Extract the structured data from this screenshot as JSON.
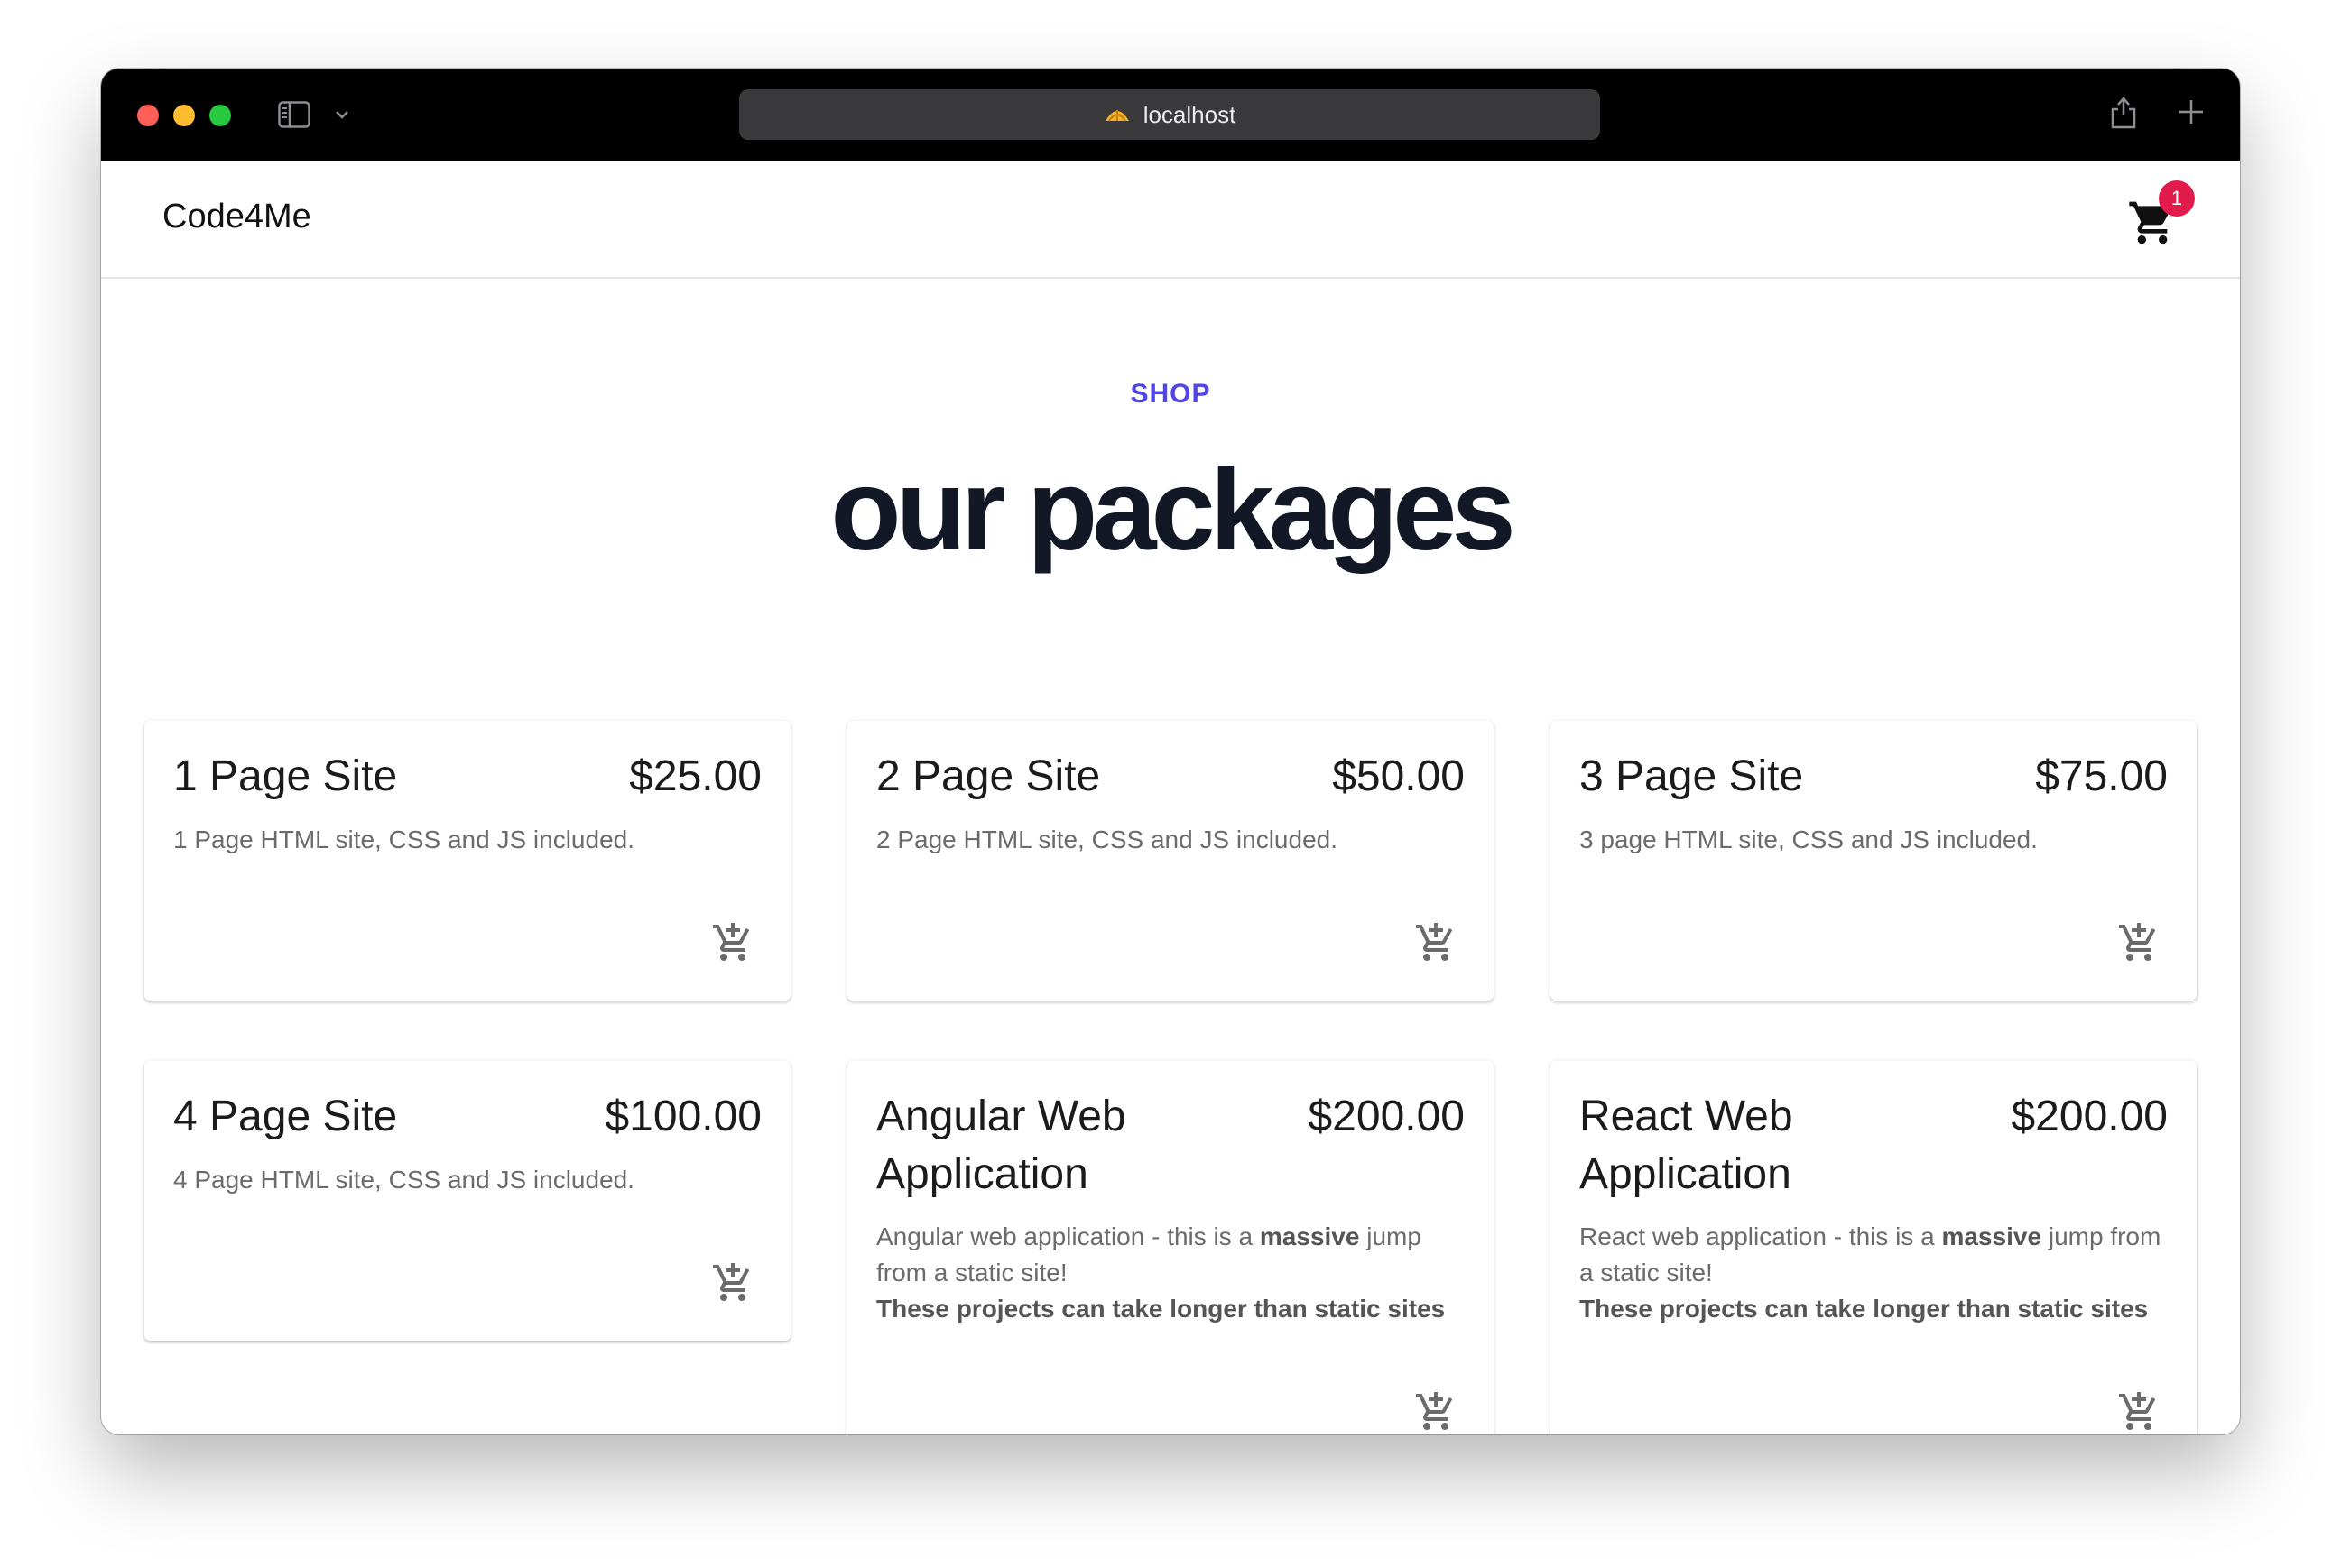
{
  "browser": {
    "url": "localhost"
  },
  "nav": {
    "brand": "Code4Me",
    "cart_count": "1"
  },
  "hero": {
    "kicker": "SHOP",
    "heading": "our packages"
  },
  "packages": [
    {
      "title": "1 Page Site",
      "price": "$25.00",
      "description": "1 Page HTML site, CSS and JS included."
    },
    {
      "title": "2 Page Site",
      "price": "$50.00",
      "description": "2 Page HTML site, CSS and JS included."
    },
    {
      "title": "3 Page Site",
      "price": "$75.00",
      "description": "3 page HTML site, CSS and JS included."
    },
    {
      "title": "4 Page Site",
      "price": "$100.00",
      "description": "4 Page HTML site, CSS and JS included."
    },
    {
      "title": "Angular Web Application",
      "price": "$200.00",
      "desc_pre": "Angular web application - this is a ",
      "desc_bold": "massive",
      "desc_post": " jump from a static site!",
      "desc_note": "These projects can take longer than static sites"
    },
    {
      "title": "React Web Application",
      "price": "$200.00",
      "desc_pre": "React web application - this is a ",
      "desc_bold": "massive",
      "desc_post": " jump from a static site!",
      "desc_note": "These projects can take longer than static sites"
    }
  ]
}
